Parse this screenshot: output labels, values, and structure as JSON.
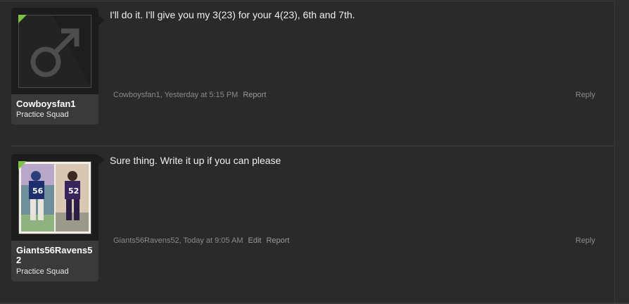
{
  "posts": [
    {
      "username": "Cowboysfan1",
      "user_title": "Practice Squad",
      "avatar_icon": "male-symbol-icon",
      "message": "I'll do it. I'll give you my 3(23) for your 4(23), 6th and 7th.",
      "author": "Cowboysfan1",
      "timestamp": "Yesterday at 5:15 PM",
      "report_label": "Report",
      "reply_label": "Reply"
    },
    {
      "username": "Giants56Ravens52",
      "user_title": "Practice Squad",
      "avatar_icon": "football-players-photo",
      "message": "Sure thing. Write it up if you can please",
      "author": "Giants56Ravens52",
      "timestamp": "Today at 9:05 AM",
      "edit_label": "Edit",
      "report_label": "Report",
      "reply_label": "Reply"
    }
  ],
  "colors": {
    "background": "#2a2a2a",
    "accent_green": "#7dc242",
    "card": "#3a3a3a"
  }
}
